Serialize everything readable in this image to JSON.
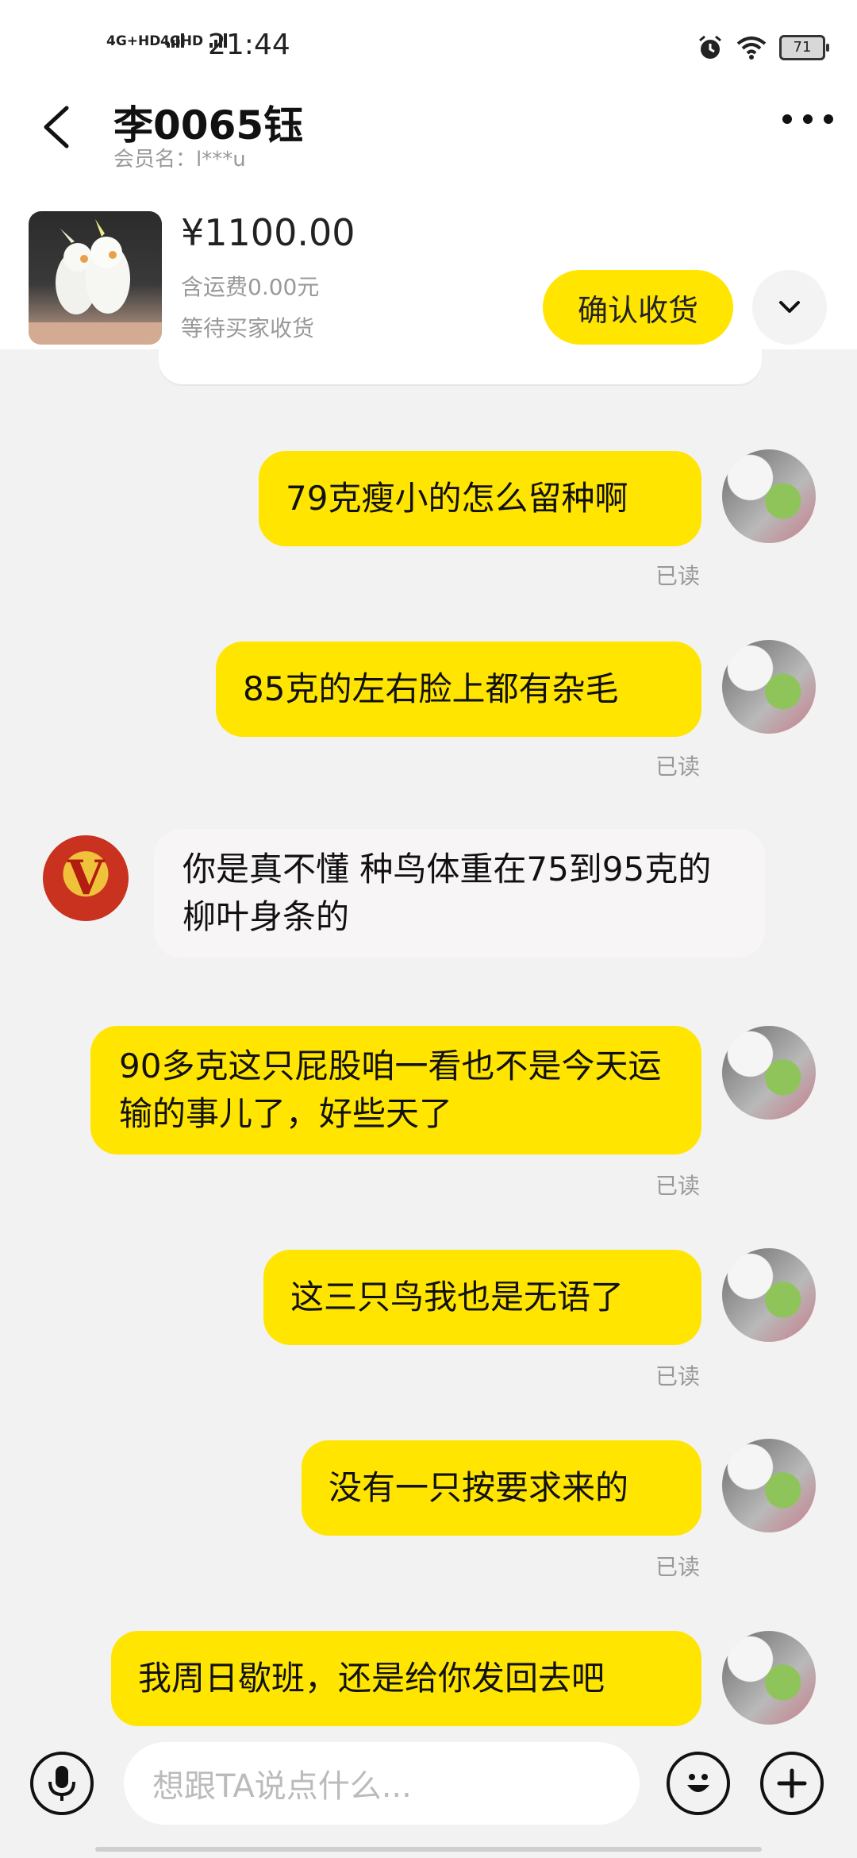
{
  "status": {
    "net1": "4G+HD",
    "net2": "4GHD",
    "time": "21:44",
    "battery": "71"
  },
  "header": {
    "title": "李0065钰",
    "subtitle": "会员名：l***u"
  },
  "product": {
    "price": "¥1100.00",
    "shipping": "含运费0.00元",
    "status": "等待买家收货",
    "confirm_label": "确认收货"
  },
  "messages": [
    {
      "from": "me",
      "text": "79克瘦小的怎么留种啊",
      "read": "已读"
    },
    {
      "from": "me",
      "text": "85克的左右脸上都有杂毛",
      "read": "已读"
    },
    {
      "from": "other",
      "text": "你是真不懂  种鸟体重在75到95克的 柳叶身条的"
    },
    {
      "from": "me",
      "text": "90多克这只屁股咱一看也不是今天运输的事儿了，好些天了",
      "read": "已读"
    },
    {
      "from": "me",
      "text": "这三只鸟我也是无语了",
      "read": "已读"
    },
    {
      "from": "me",
      "text": "没有一只按要求来的",
      "read": "已读"
    },
    {
      "from": "me",
      "text": "我周日歇班，还是给你发回去吧"
    }
  ],
  "input": {
    "placeholder": "想跟TA说点什么..."
  }
}
